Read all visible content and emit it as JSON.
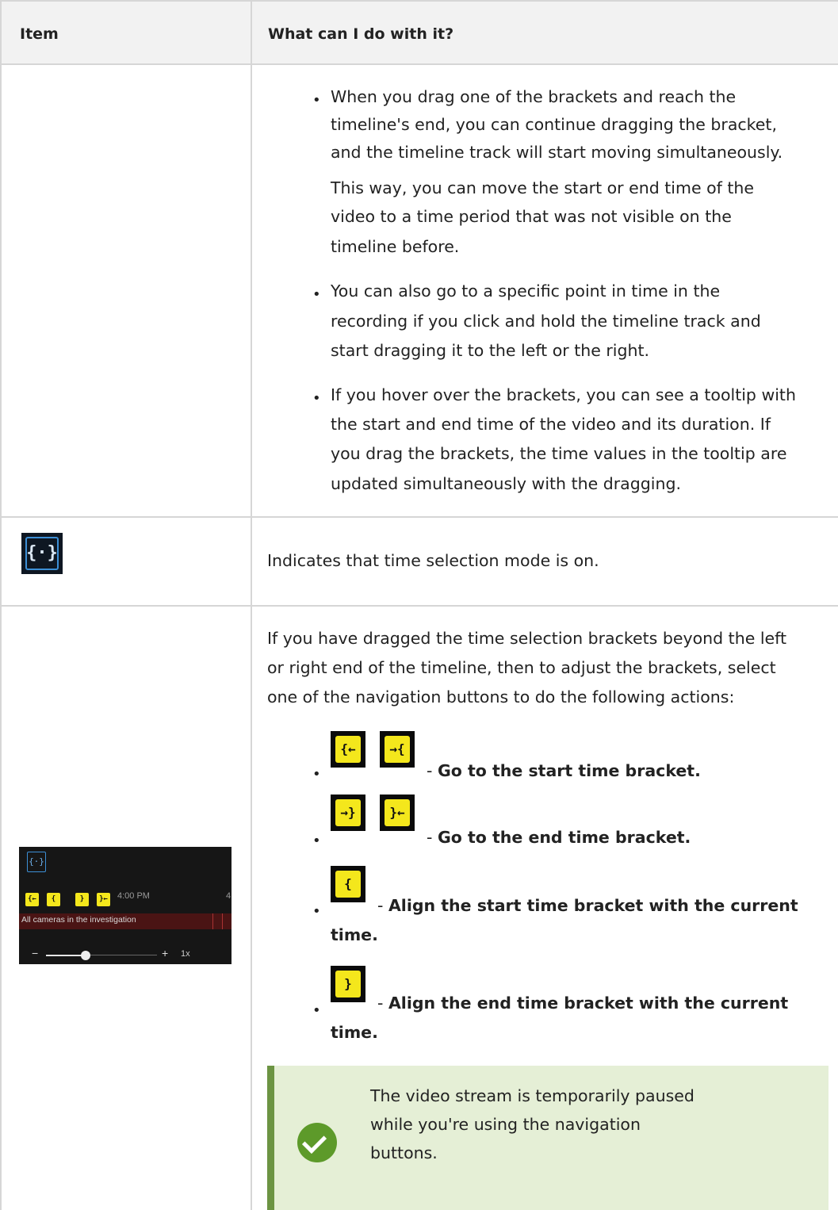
{
  "header": {
    "item": "Item",
    "question": "What can I do with it?"
  },
  "row1": {
    "bullets": [
      {
        "lines": [
          "When you drag one of the brackets and reach the",
          "timeline's end, you can continue dragging the bracket,",
          "and the timeline track will start moving simultaneously.",
          "This way, you can move the start or end time of the",
          "video to a time period that was not visible on the",
          "timeline before."
        ]
      },
      {
        "lines": [
          "You can also go to a specific point in time in the",
          "recording if you click and hold the timeline track and",
          "start dragging it to the left or the right."
        ]
      },
      {
        "lines": [
          "If you hover over the brackets, you can see a tooltip with",
          "the start and end time of the video and its duration. If",
          "you drag the brackets, the time values in the tooltip are",
          "updated simultaneously with the dragging."
        ]
      }
    ]
  },
  "row2": {
    "icon": "time-selection-mode-icon",
    "text": "Indicates that time selection mode is on."
  },
  "row3": {
    "intro_lines": [
      "If you have dragged the time selection brackets beyond the left",
      "or right end of the timeline, then to adjust the brackets, select",
      "one of the navigation buttons to do the following actions:"
    ],
    "actions": [
      {
        "icons": [
          "go-to-start-bracket-icon",
          "go-to-start-bracket-alt-icon"
        ],
        "text_lines": [
          "Go to the start time bracket."
        ]
      },
      {
        "icons": [
          "go-to-end-bracket-icon",
          "go-to-end-bracket-alt-icon"
        ],
        "text_lines": [
          "Go to the end time bracket."
        ]
      },
      {
        "icons": [
          "align-start-bracket-icon"
        ],
        "text_lines": [
          "Align the start time bracket with the current",
          "time."
        ]
      },
      {
        "icons": [
          "align-end-bracket-icon"
        ],
        "text_lines": [
          "Align the end time bracket with the current",
          "time."
        ]
      }
    ],
    "dash": "-",
    "timeline_screenshot": {
      "time_label": "4:00 PM",
      "edge_label": "4",
      "track_label": "All cameras in the investigation",
      "minus": "−",
      "plus": "+",
      "speed": "1x"
    },
    "tip": {
      "icon": "checkmark-icon",
      "lines": [
        "The video stream is temporarily paused",
        "while you're using the navigation",
        "buttons."
      ]
    }
  },
  "colors": {
    "border": "#d6d6d6",
    "header_bg": "#f2f2f2",
    "icon_yellow": "#f4e71c",
    "tip_bg": "#e5efd6",
    "tip_stripe": "#6c9443",
    "check_green": "#5d9a2a",
    "selection_blue": "#3c8fd6"
  }
}
